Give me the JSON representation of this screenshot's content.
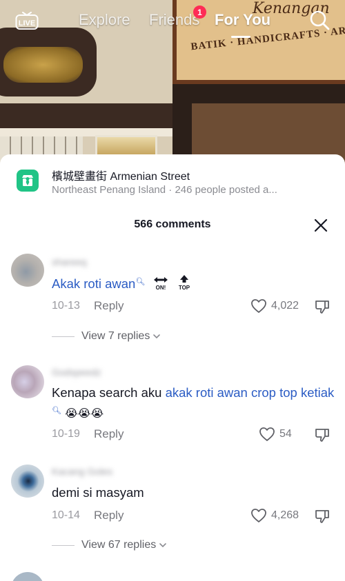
{
  "nav": {
    "live_label": "LIVE",
    "tabs": [
      {
        "label": "Explore",
        "active": false
      },
      {
        "label": "Friends",
        "active": false,
        "badge": "1"
      },
      {
        "label": "For You",
        "active": true
      }
    ]
  },
  "background": {
    "sign_script": "Kenangan",
    "sign_line": "BATIK · HANDICRAFTS · ART"
  },
  "location": {
    "title": "檳城壁畫街 Armenian Street",
    "subtitle": "Northeast Penang Island · 246 people posted a..."
  },
  "comments_header": {
    "count_label": "566 comments"
  },
  "comments": [
    {
      "username": "shareeq",
      "text_keyword": "Akak roti awan",
      "extra_icons": [
        "ON!",
        "TOP"
      ],
      "date": "10-13",
      "reply_label": "Reply",
      "likes": "4,022",
      "view_replies": "View 7 replies"
    },
    {
      "username": "Godspeedz",
      "text_plain": "Kenapa search aku ",
      "text_keyword": "akak roti awan crop top ketiak",
      "emojis": "😭😭😭",
      "date": "10-19",
      "reply_label": "Reply",
      "likes": "54"
    },
    {
      "username": "Kacang Goles",
      "text_plain": "demi si masyam",
      "date": "10-14",
      "reply_label": "Reply",
      "likes": "4,268",
      "view_replies": "View 67 replies"
    }
  ],
  "colors": {
    "accent_blue": "#2b5cc4",
    "badge_red": "#fe2c55",
    "location_green": "#20c486"
  }
}
